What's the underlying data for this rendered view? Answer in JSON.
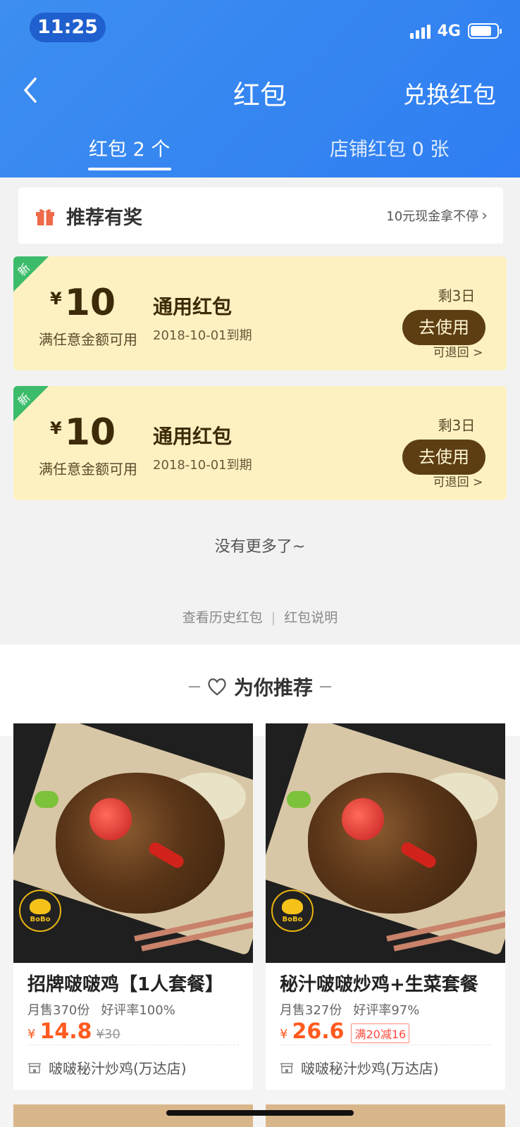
{
  "status_bar": {
    "time": "11:25",
    "network": "4G"
  },
  "nav": {
    "title": "红包",
    "exchange_label": "兑换红包"
  },
  "tabs": [
    {
      "label": "红包 2 个",
      "active": true
    },
    {
      "label": "店铺红包 0 张",
      "active": false
    }
  ],
  "referral": {
    "title": "推荐有奖",
    "promo": "10元现金拿不停"
  },
  "coupons": [
    {
      "badge": "新",
      "currency": "¥",
      "amount": "10",
      "condition": "满任意金额可用",
      "name": "通用红包",
      "expire": "2018-10-01到期",
      "remaining": "剩3日",
      "use_label": "去使用",
      "refund": "可退回 >"
    },
    {
      "badge": "新",
      "currency": "¥",
      "amount": "10",
      "condition": "满任意金额可用",
      "name": "通用红包",
      "expire": "2018-10-01到期",
      "remaining": "剩3日",
      "use_label": "去使用",
      "refund": "可退回 >"
    }
  ],
  "no_more": "没有更多了~",
  "footer_links": {
    "history": "查看历史红包",
    "explain": "红包说明"
  },
  "recommend": {
    "title": "为你推荐",
    "items": [
      {
        "name": "招牌啵啵鸡【1人套餐】",
        "monthly_sales": "月售370份",
        "rating": "好评率100%",
        "currency": "¥",
        "price": "14.8",
        "old_price": "¥30",
        "promo": "",
        "shop": "啵啵秘汁炒鸡(万达店)",
        "logo_text": "BoBo"
      },
      {
        "name": "秘汁啵啵炒鸡+生菜套餐",
        "monthly_sales": "月售327份",
        "rating": "好评率97%",
        "currency": "¥",
        "price": "26.6",
        "old_price": "",
        "promo": "满20减16",
        "shop": "啵啵秘汁炒鸡(万达店)",
        "logo_text": "BoBo"
      }
    ]
  },
  "colors": {
    "header": "#2f7ef2",
    "coupon_bg": "#fdf1c2",
    "use_button": "#5c3e12",
    "price": "#ff5a1f",
    "new_badge": "#3cbc6b"
  }
}
